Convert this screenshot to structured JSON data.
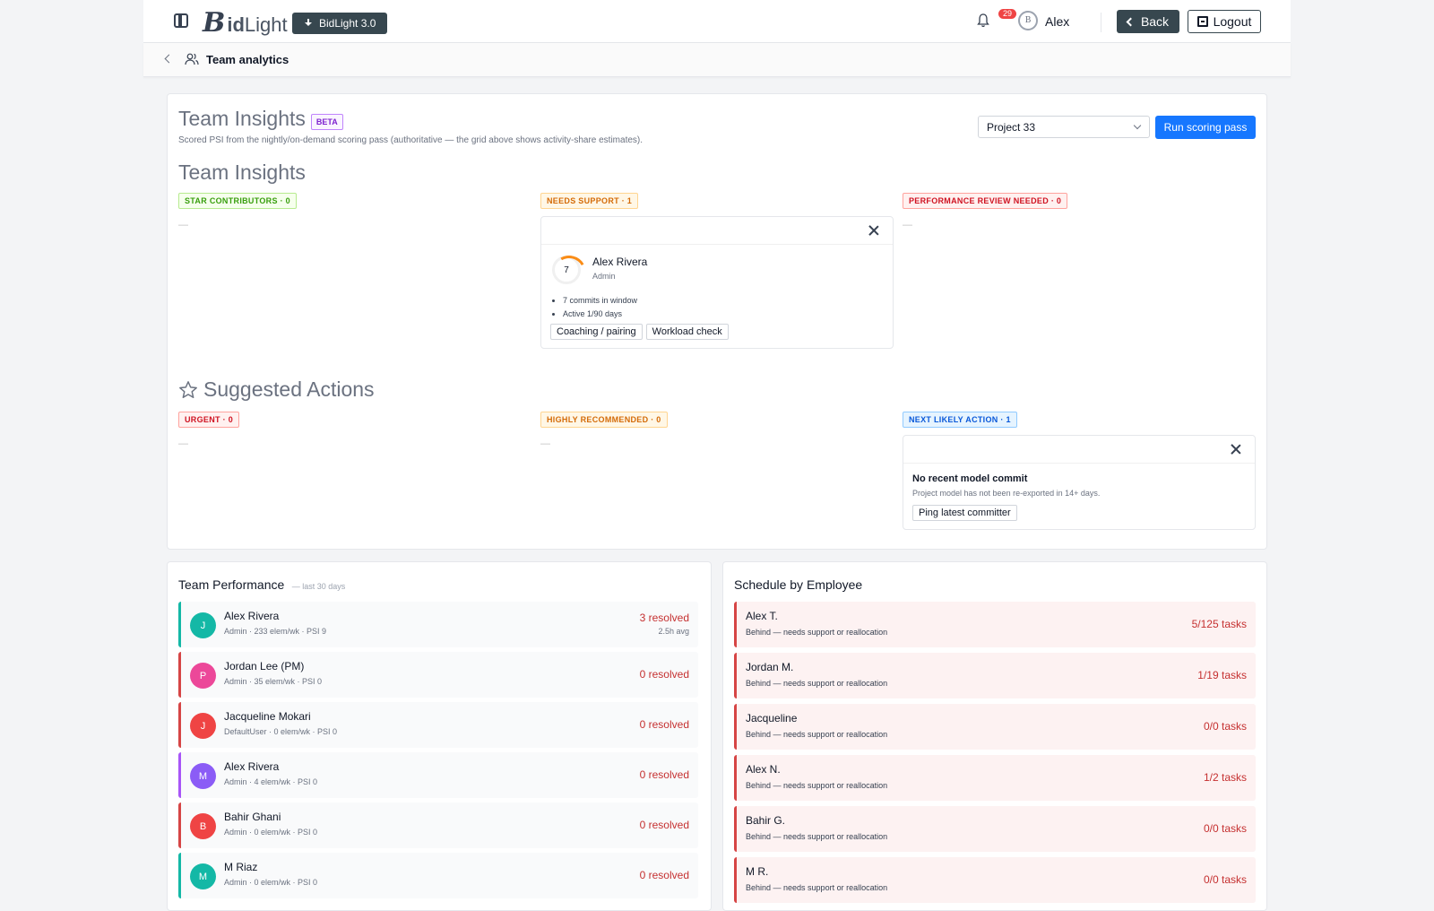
{
  "header": {
    "logo_b": "B",
    "logo_text": "id",
    "logo_text2": "Light",
    "version_button": "BidLight 3.0",
    "notification_count": "29",
    "avatar_initials": "B",
    "user_name": "Alex",
    "back_label": "Back",
    "logout_label": "Logout"
  },
  "breadcrumb": {
    "label": "Team analytics"
  },
  "insights": {
    "title": "Team Insights",
    "beta": "BETA",
    "description": "Scored PSI from the nightly/on-demand scoring pass (authoritative — the grid above shows activity-share estimates).",
    "project_select": "Project 33",
    "run_button": "Run scoring pass",
    "section_title": "Team Insights",
    "columns": [
      {
        "tag": "STAR CONTRIBUTORS · 0",
        "empty": "—"
      },
      {
        "tag": "NEEDS SUPPORT · 1"
      },
      {
        "tag": "PERFORMANCE REVIEW NEEDED · 0",
        "empty": "—"
      }
    ],
    "support_card": {
      "score": "7",
      "name": "Alex Rivera",
      "role": "Admin",
      "bullets": [
        "7 commits in window",
        "Active 1/90 days"
      ],
      "chips": [
        "Coaching / pairing",
        "Workload check"
      ]
    }
  },
  "actions": {
    "title": "Suggested Actions",
    "columns": [
      {
        "tag": "URGENT · 0",
        "empty": "—"
      },
      {
        "tag": "HIGHLY RECOMMENDED · 0",
        "empty": "—"
      },
      {
        "tag": "NEXT LIKELY ACTION · 1"
      }
    ],
    "next_card": {
      "title": "No recent model commit",
      "desc": "Project model has not been re-exported in 14+ days.",
      "chip": "Ping latest committer"
    }
  },
  "performance": {
    "title": "Team Performance",
    "subtitle": "— last 30 days",
    "rows": [
      {
        "initial": "J",
        "name": "Alex Rivera",
        "meta": "Admin · 233 elem/wk · PSI 9",
        "resolved": "3 resolved",
        "avg": "2.5h avg",
        "color": "#14b8a6",
        "border": "#14b8a6"
      },
      {
        "initial": "P",
        "name": "Jordan Lee (PM)",
        "meta": "Admin · 35 elem/wk · PSI 0",
        "resolved": "0 resolved",
        "avg": "",
        "color": "#ec4899",
        "border": "#d64545"
      },
      {
        "initial": "J",
        "name": "Jacqueline Mokari",
        "meta": "DefaultUser · 0 elem/wk · PSI 0",
        "resolved": "0 resolved",
        "avg": "",
        "color": "#ef4444",
        "border": "#d64545"
      },
      {
        "initial": "M",
        "name": "Alex Rivera",
        "meta": "Admin · 4 elem/wk · PSI 0",
        "resolved": "0 resolved",
        "avg": "",
        "color": "#8b5cf6",
        "border": "#a855f7"
      },
      {
        "initial": "B",
        "name": "Bahir Ghani",
        "meta": "Admin · 0 elem/wk · PSI 0",
        "resolved": "0 resolved",
        "avg": "",
        "color": "#ef4444",
        "border": "#d64545"
      },
      {
        "initial": "M",
        "name": "M Riaz",
        "meta": "Admin · 0 elem/wk · PSI 0",
        "resolved": "0 resolved",
        "avg": "",
        "color": "#14b8a6",
        "border": "#14b8a6"
      }
    ]
  },
  "schedule": {
    "title": "Schedule by Employee",
    "rows": [
      {
        "name": "Alex T.",
        "status": "Behind — needs support or reallocation",
        "tasks": "5/125 tasks"
      },
      {
        "name": "Jordan M.",
        "status": "Behind — needs support or reallocation",
        "tasks": "1/19 tasks"
      },
      {
        "name": "Jacqueline",
        "status": "Behind — needs support or reallocation",
        "tasks": "0/0 tasks"
      },
      {
        "name": "Alex N.",
        "status": "Behind — needs support or reallocation",
        "tasks": "1/2 tasks"
      },
      {
        "name": "Bahir G.",
        "status": "Behind — needs support or reallocation",
        "tasks": "0/0 tasks"
      },
      {
        "name": "M R.",
        "status": "Behind — needs support or reallocation",
        "tasks": "0/0 tasks"
      }
    ]
  }
}
